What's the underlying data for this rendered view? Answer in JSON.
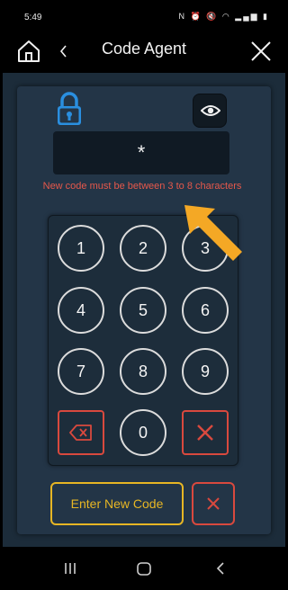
{
  "status_bar": {
    "time": "5:49",
    "icons": [
      "nfc-icon",
      "alarm-icon",
      "mute-icon",
      "wifi-icon",
      "signal-icon",
      "battery-icon"
    ]
  },
  "header": {
    "title": "Code Agent",
    "icons": [
      "home-icon",
      "back-chevron-icon",
      "close-icon"
    ]
  },
  "code": {
    "value": "*",
    "error": "New code must be between 3 to 8 characters"
  },
  "keypad": {
    "keys": [
      "1",
      "2",
      "3",
      "4",
      "5",
      "6",
      "7",
      "8",
      "9",
      "0"
    ],
    "delete_icon": "backspace-icon",
    "clear_icon": "x-icon"
  },
  "actions": {
    "enter_label": "Enter New Code",
    "cancel_icon": "x-icon"
  },
  "colors": {
    "background": "#1c2c3a",
    "panel": "#233547",
    "accent_blue": "#2a8fe0",
    "error_red": "#e6584b",
    "accent_yellow": "#e7b624",
    "arrow": "#f4a825"
  }
}
